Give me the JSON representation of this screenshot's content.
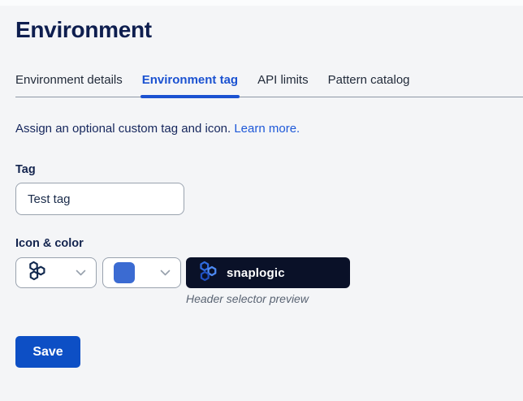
{
  "header": {
    "title": "Environment"
  },
  "tabs": {
    "items": [
      {
        "label": "Environment details",
        "active": false
      },
      {
        "label": "Environment tag",
        "active": true
      },
      {
        "label": "API limits",
        "active": false
      },
      {
        "label": "Pattern catalog",
        "active": false
      }
    ]
  },
  "intro": {
    "text": "Assign an optional custom tag and icon.",
    "link_label": "Learn more."
  },
  "tag_field": {
    "label": "Tag",
    "value": "Test tag"
  },
  "icon_color": {
    "label": "Icon & color",
    "icon_dropdown": {
      "selected_icon": "snaplogic-hexagons-icon"
    },
    "color_dropdown": {
      "selected_color": "#3b6bd2"
    },
    "preview": {
      "brand_text": "snaplogic",
      "caption": "Header selector preview"
    }
  },
  "actions": {
    "save_label": "Save"
  },
  "colors": {
    "accent_blue": "#1b52d1",
    "link_blue": "#1d58d8",
    "title_navy": "#0e1e4f",
    "preview_bg": "#0a1128",
    "save_blue": "#0d4fc5",
    "swatch_blue": "#3b6bd2",
    "divider_gray": "#8d97a5"
  }
}
